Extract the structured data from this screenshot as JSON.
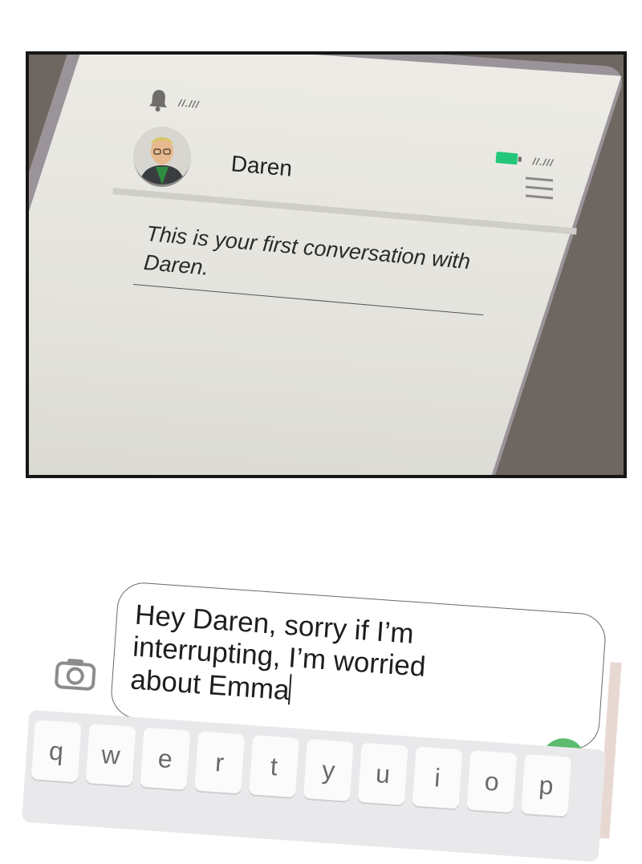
{
  "chat_screen": {
    "contact_name": "Daren",
    "empty_state_text": "This is your first conversation with Daren.",
    "status_icons": {
      "left": [
        "bell-icon",
        "signal-glyphs"
      ],
      "right": [
        "battery-icon",
        "signal-glyphs"
      ]
    },
    "colors": {
      "battery_fill": "#22c77a",
      "screen_bg": "#e6e5df",
      "frame_bg": "#6e6660"
    }
  },
  "compose": {
    "message_text": "Hey Daren, sorry if I’m\ninterrupting, I’m worried\nabout Emma",
    "send_icon": "arrow-up-icon",
    "camera_icon": "camera-icon",
    "colors": {
      "send_button": "#5cbb6e"
    }
  },
  "keyboard": {
    "visible_keys": [
      "q",
      "w",
      "e",
      "r",
      "t",
      "y",
      "u",
      "i",
      "o",
      "p"
    ]
  }
}
